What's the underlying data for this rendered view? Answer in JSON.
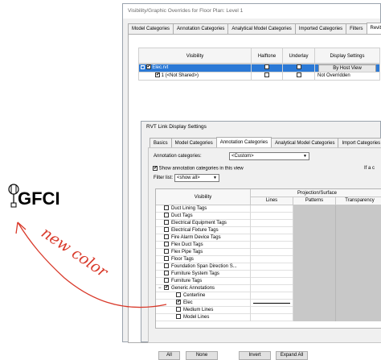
{
  "outer": {
    "title": "Visibility/Graphic Overrides for Floor Plan: Level 1",
    "tabs": [
      "Model Categories",
      "Annotation Categories",
      "Analytical Model Categories",
      "Imported Categories",
      "Filters",
      "Revit Links"
    ],
    "grid_headers": [
      "Visibility",
      "Halftone",
      "Underlay",
      "Display Settings"
    ],
    "rows": [
      {
        "expander": "−",
        "name": "Elec.rvt",
        "visible": true,
        "halftone": false,
        "underlay": false,
        "display": "By Host View",
        "selected": true
      },
      {
        "expander": "",
        "name": "1 (<Not Shared>)",
        "visible": true,
        "halftone": false,
        "underlay": false,
        "display": "Not Overridden",
        "selected": false
      }
    ]
  },
  "inner": {
    "title": "RVT Link Display Settings",
    "tabs": [
      "Basics",
      "Model Categories",
      "Annotation Categories",
      "Analytical Model Categories",
      "Import Categories"
    ],
    "annotation_categories_label": "Annotation categories:",
    "annotation_categories_value": "<Custom>",
    "show_label": "Show annotation categories in this view",
    "if_text": "If a c",
    "filter_label": "Filter list:",
    "filter_value": "<show all>",
    "table": {
      "col_visibility": "Visibility",
      "col_projection": "Projection/Surface",
      "col_lines": "Lines",
      "col_patterns": "Patterns",
      "col_transparency": "Transparency"
    },
    "rows": [
      {
        "name": "Duct Lining Tags",
        "indent": 1,
        "checked": false
      },
      {
        "name": "Duct Tags",
        "indent": 1,
        "checked": false
      },
      {
        "name": "Electrical Equipment Tags",
        "indent": 1,
        "checked": false
      },
      {
        "name": "Electrical Fixture Tags",
        "indent": 1,
        "checked": false
      },
      {
        "name": "Fire Alarm Device Tags",
        "indent": 1,
        "checked": false
      },
      {
        "name": "Flex Duct Tags",
        "indent": 1,
        "checked": false
      },
      {
        "name": "Flex Pipe Tags",
        "indent": 1,
        "checked": false
      },
      {
        "name": "Floor Tags",
        "indent": 1,
        "checked": false
      },
      {
        "name": "Foundation Span Direction S...",
        "indent": 1,
        "checked": false
      },
      {
        "name": "Furniture System Tags",
        "indent": 1,
        "checked": false
      },
      {
        "name": "Furniture Tags",
        "indent": 1,
        "checked": false
      },
      {
        "name": "Generic Annotations",
        "indent": 1,
        "checked": true,
        "expander": "−"
      },
      {
        "name": "Centerline",
        "indent": 2,
        "checked": false
      },
      {
        "name": "Elec",
        "indent": 2,
        "checked": true,
        "line": true
      },
      {
        "name": "Medium Lines",
        "indent": 2,
        "checked": false
      },
      {
        "name": "Model Lines",
        "indent": 2,
        "checked": false
      }
    ],
    "buttons": [
      "All",
      "None",
      "Invert",
      "Expand All"
    ]
  },
  "annotation": {
    "gfci_text": "GFCI",
    "handwritten_note": "new color",
    "note_color": "#d93a2b"
  }
}
